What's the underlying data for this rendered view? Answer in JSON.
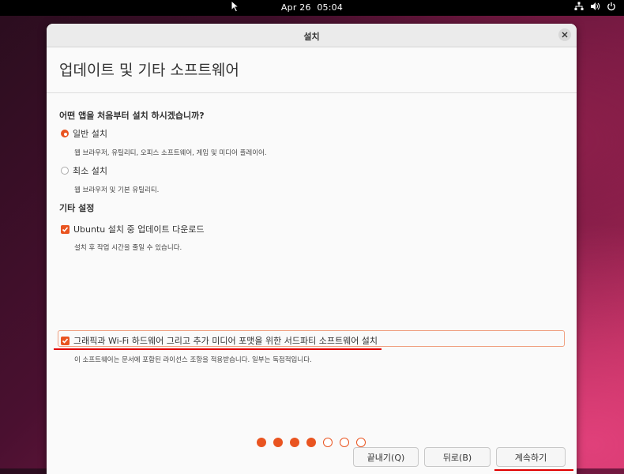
{
  "topbar": {
    "date": "Apr 26",
    "time": "05:04"
  },
  "window": {
    "title": "설치",
    "heading": "업데이트 및 기타 소프트웨어"
  },
  "install_type": {
    "question": "어떤 앱을 처음부터 설치 하시겠습니까?",
    "options": [
      {
        "label": "일반 설치",
        "description": "웹 브라우저, 유틸리티, 오피스  소프트웨어, 게임 및 미디어 플레이어.",
        "selected": true
      },
      {
        "label": "최소 설치",
        "description": "웹 브라우저 및 기본 유틸리티.",
        "selected": false
      }
    ]
  },
  "other_settings": {
    "title": "기타 설정",
    "items": [
      {
        "label": "Ubuntu 설치 중 업데이트 다운로드",
        "description": "설치 후 작업 시간을 줄일 수 있습니다.",
        "checked": true
      },
      {
        "label": "그래픽과 Wi-Fi 하드웨어 그리고 추가 미디어 포맷을 위한 서드파티 소프트웨어 설치",
        "description": "이 소프트웨어는 문서에 포함된 라이선스 조항을 적용받습니다. 일부는 독점적입니다.",
        "checked": true
      }
    ]
  },
  "buttons": {
    "quit": "끝내기(Q)",
    "back": "뒤로(B)",
    "continue": "계속하기"
  },
  "progress": {
    "total_steps": 7,
    "completed_steps": 4
  },
  "colors": {
    "accent": "#e95420",
    "annotation": "#e00000"
  }
}
